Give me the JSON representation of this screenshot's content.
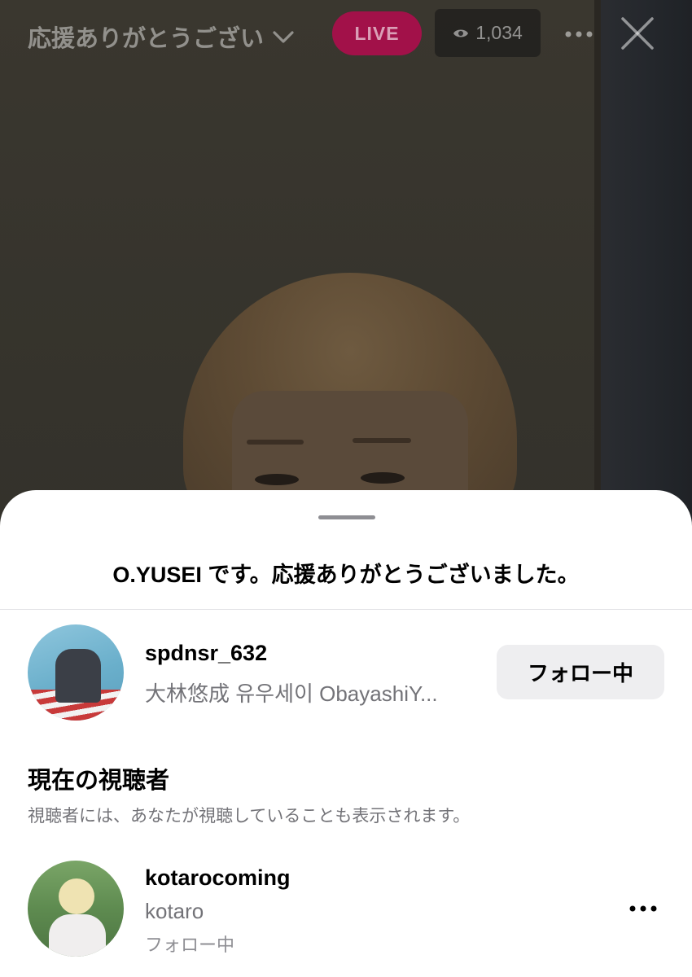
{
  "live": {
    "title": "応援ありがとうござい",
    "badge": "LIVE",
    "viewer_count": "1,034"
  },
  "sheet": {
    "title": "O.YUSEI です。応援ありがとうございました。",
    "host": {
      "username": "spdnsr_632",
      "subtitle": "大林悠成 유우세이 ObayashiY...",
      "follow_label": "フォロー中"
    },
    "viewers_section": {
      "title": "現在の視聴者",
      "subtitle": "視聴者には、あなたが視聴していることも表示されます。",
      "items": [
        {
          "username": "kotarocoming",
          "display_name": "kotaro",
          "status": "フォロー中"
        }
      ]
    }
  },
  "colors": {
    "live_badge": "#a21149",
    "follow_button_bg": "#eeeef0",
    "secondary_text": "#737378"
  },
  "icons": {
    "title_dropdown": "chevron-down-icon",
    "viewers": "eye-icon",
    "more": "more-horizontal-icon",
    "close": "close-icon"
  }
}
